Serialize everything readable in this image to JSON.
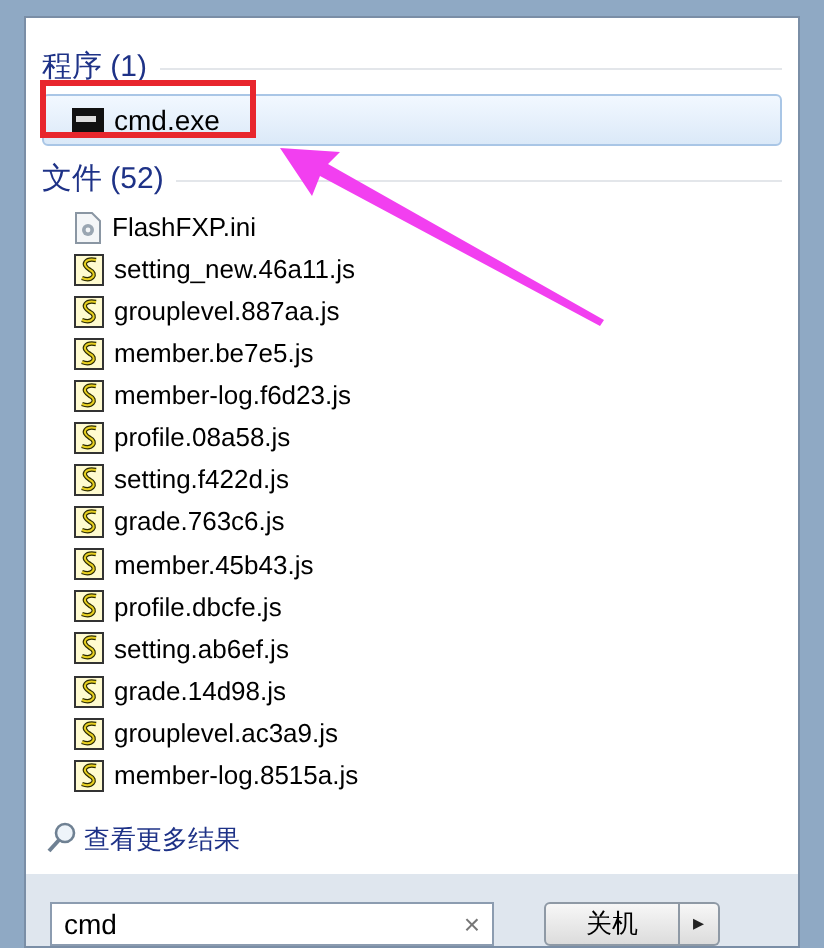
{
  "groups": [
    {
      "title": "程序 (1)",
      "items": [
        {
          "name": "cmd.exe",
          "kind": "console",
          "selected": true
        }
      ]
    },
    {
      "title": "文件 (52)",
      "items": [
        {
          "name": "FlashFXP.ini",
          "kind": "config",
          "selected": false
        },
        {
          "name": "setting_new.46a11.js",
          "kind": "script",
          "selected": false
        },
        {
          "name": "grouplevel.887aa.js",
          "kind": "script",
          "selected": false
        },
        {
          "name": "member.be7e5.js",
          "kind": "script",
          "selected": false
        },
        {
          "name": "member-log.f6d23.js",
          "kind": "script",
          "selected": false
        },
        {
          "name": "profile.08a58.js",
          "kind": "script",
          "selected": false
        },
        {
          "name": "setting.f422d.js",
          "kind": "script",
          "selected": false
        },
        {
          "name": "grade.763c6.js",
          "kind": "script",
          "selected": false
        },
        {
          "name": "member.45b43.js",
          "kind": "script",
          "selected": false
        },
        {
          "name": "profile.dbcfe.js",
          "kind": "script",
          "selected": false
        },
        {
          "name": "setting.ab6ef.js",
          "kind": "script",
          "selected": false
        },
        {
          "name": "grade.14d98.js",
          "kind": "script",
          "selected": false
        },
        {
          "name": "grouplevel.ac3a9.js",
          "kind": "script",
          "selected": false
        },
        {
          "name": "member-log.8515a.js",
          "kind": "script",
          "selected": false
        }
      ]
    }
  ],
  "more_results": "查看更多结果",
  "search": {
    "value": "cmd",
    "clear": "×"
  },
  "shutdown": {
    "label": "关机",
    "arrow": "▸"
  }
}
